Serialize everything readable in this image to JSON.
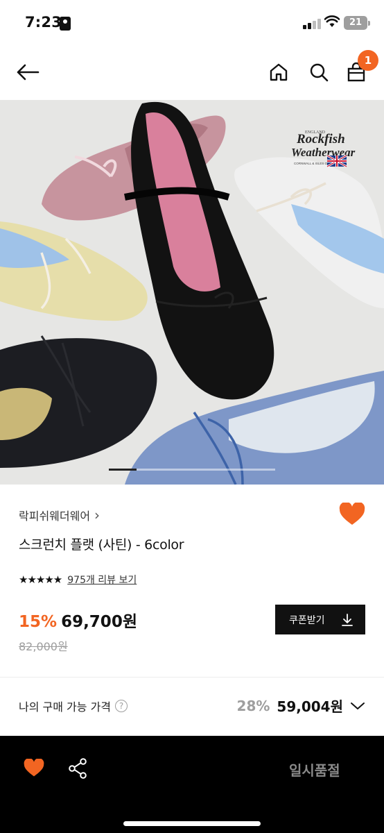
{
  "status_bar": {
    "time": "7:23",
    "battery": "21"
  },
  "header": {
    "cart_count": "1"
  },
  "hero": {
    "logo_line1": "Rockfish",
    "logo_line2": "Weatherwear",
    "logo_sub": "CORNWALL & ISLES OF SCILLY",
    "logo_top": "ENGLAND"
  },
  "product": {
    "brand": "락피쉬웨더웨어",
    "brand_arrow": "›",
    "title": "스크런치 플랫 (사틴) - 6color",
    "stars": "★★★★★",
    "review_link": "975개 리뷰 보기",
    "discount": "15%",
    "price": "69,700원",
    "original_price": "82,000원",
    "coupon_label": "쿠폰받기"
  },
  "my_price": {
    "label": "나의 구매 가능 가격",
    "help": "?",
    "discount": "28%",
    "price": "59,004원"
  },
  "bottom_bar": {
    "status_label": "일시품절"
  },
  "colors": {
    "accent": "#f26522",
    "black": "#111111",
    "muted": "#9e9e9e"
  }
}
